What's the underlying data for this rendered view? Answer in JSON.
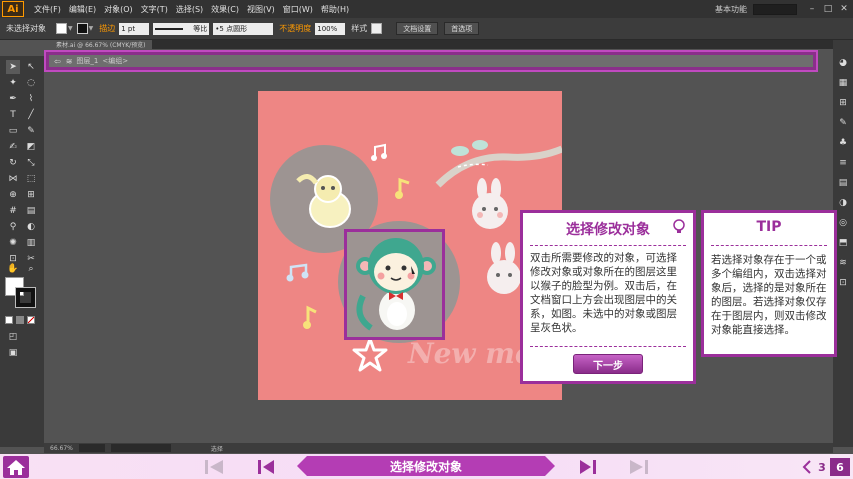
{
  "app": {
    "logo": "Ai",
    "menus": [
      "文件(F)",
      "编辑(E)",
      "对象(O)",
      "文字(T)",
      "选择(S)",
      "效果(C)",
      "视图(V)",
      "窗口(W)",
      "帮助(H)"
    ],
    "workspace": "基本功能",
    "window_controls": [
      "minimize-icon",
      "maximize-icon",
      "close-icon"
    ]
  },
  "control_bar": {
    "selection_status": "未选择对象",
    "stroke_label": "描边",
    "stroke_weight": "1 pt",
    "stroke_style": "等比",
    "brush": "5 点圆形",
    "opacity_label": "不透明度",
    "opacity_value": "100%",
    "style_label": "样式",
    "doc_setup_button": "文档设置",
    "prefs_button": "首选项",
    "colors": {
      "fill": "#ffffff",
      "stroke": "#111111",
      "accent": "#ff9a00"
    }
  },
  "document": {
    "tab_title": "素材.ai @ 66.67% (CMYK/预览)",
    "isolation_breadcrumb": "图层_1",
    "isolation_sub": "<编组>",
    "zoom": "66.67%",
    "status_text": "选择"
  },
  "artwork": {
    "watermark_text": "New mod",
    "colors": {
      "artboard": "#ee8684",
      "grey_circle": "#9d9492",
      "monkey": "#3fa78f"
    }
  },
  "tips": {
    "card1": {
      "title": "选择修改对象",
      "body": "双击所需要修改的对象，可选择修改对象或对象所在的图层这里以猴子的脸型为例。双击后，在文档窗口上方会出现图层中的关系，如图。未选中的对象或图层呈灰色状。",
      "next_button": "下一步",
      "icon": "lightbulb-icon"
    },
    "card2": {
      "title": "TIP",
      "body": "若选择对象存在于一个或多个编组内，双击选择对象后，选择的是对象所在的图层。若选择对象仅存在于图层内，则双击修改对象能直接选择。"
    },
    "accent": "#9b2f9b"
  },
  "navigation": {
    "title": "选择修改对象",
    "current_page": "3",
    "total_pages": "6",
    "icons": [
      "home-icon",
      "first-page-icon",
      "prev-page-icon",
      "next-page-icon",
      "last-page-icon",
      "back-icon"
    ]
  }
}
